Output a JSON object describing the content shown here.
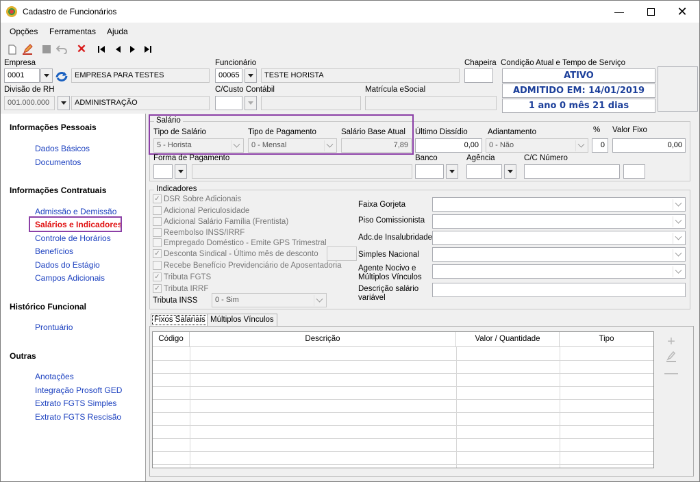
{
  "window": {
    "title": "Cadastro de Funcionários",
    "min_icon": "minimize-icon",
    "max_icon": "maximize-icon",
    "close_icon": "close-icon"
  },
  "menu": [
    {
      "label": "Opções"
    },
    {
      "label": "Ferramentas"
    },
    {
      "label": "Ajuda"
    }
  ],
  "toolbar": {
    "icons": [
      "new-document-icon",
      "edit-icon",
      "save-icon",
      "undo-icon",
      "delete-icon",
      "first-record-icon",
      "previous-record-icon",
      "next-record-icon",
      "last-record-icon"
    ]
  },
  "header": {
    "empresa_label": "Empresa",
    "empresa_code": "0001",
    "empresa_name": "EMPRESA PARA TESTES",
    "divisao_label": "Divisão de RH",
    "divisao_code": "001.000.000",
    "divisao_name": "ADMINISTRAÇÃO",
    "funcionario_label": "Funcionário",
    "funcionario_code": "00065",
    "funcionario_name": "TESTE HORISTA",
    "custo_label": "C/Custo Contábil",
    "custo_code": "",
    "custo_name": "",
    "matricula_label": "Matrícula eSocial",
    "matricula_value": "",
    "chapeira_label": "Chapeira",
    "chapeira_value": "",
    "condicao_label": "Condição Atual e Tempo de Serviço",
    "status": "ATIVO",
    "admitido": "ADMITIDO EM: 14/01/2019",
    "tempo": "1 ano 0 mês 21 dias"
  },
  "nav": {
    "sections": [
      {
        "title": "Informações Pessoais",
        "links": [
          "Dados Básicos",
          "Documentos"
        ]
      },
      {
        "title": "Informações Contratuais",
        "links": [
          "Admissão e Demissão",
          "Salários e Indicadores",
          "Controle de Horários",
          "Benefícios",
          "Dados do Estágio",
          "Campos Adicionais"
        ]
      },
      {
        "title": "Histórico Funcional",
        "links": [
          "Prontuário"
        ]
      },
      {
        "title": "Outras",
        "links": [
          "Anotações",
          "Integração Prosoft GED",
          "Extrato FGTS Simples",
          "Extrato FGTS Rescisão"
        ]
      }
    ],
    "active": "Salários e Indicadores"
  },
  "salario": {
    "group_title": "Salário",
    "tipo_salario_label": "Tipo de Salário",
    "tipo_salario_value": "5 - Horista",
    "tipo_pagamento_label": "Tipo de Pagamento",
    "tipo_pagamento_value": "0 - Mensal",
    "salario_base_label": "Salário Base Atual",
    "salario_base_value": "7,89",
    "ultimo_dissidio_label": "Último Dissídio",
    "ultimo_dissidio_value": "0,00",
    "adiantamento_label": "Adiantamento",
    "adiantamento_value": "0 - Não",
    "percent_label": "%",
    "percent_value": "0",
    "valor_fixo_label": "Valor Fixo",
    "valor_fixo_value": "0,00",
    "forma_pagamento_label": "Forma de Pagamento",
    "forma_pagamento_value": "",
    "banco_label": "Banco",
    "agencia_label": "Agência",
    "cc_numero_label": "C/C Número"
  },
  "indicadores": {
    "group_title": "Indicadores",
    "checks": [
      {
        "label": "DSR Sobre Adicionais",
        "checked": true
      },
      {
        "label": "Adicional Periculosidade",
        "checked": false
      },
      {
        "label": "Adicional Salário Família (Frentista)",
        "checked": false
      },
      {
        "label": "Reembolso INSS/IRRF",
        "checked": false
      },
      {
        "label": "Empregado Doméstico - Emite GPS Trimestral",
        "checked": false
      },
      {
        "label": "Desconta Sindical - Último mês de desconto",
        "checked": true
      },
      {
        "label": "Recebe Benefício Previdenciário de Aposentadoria",
        "checked": false
      },
      {
        "label": "Tributa FGTS",
        "checked": true
      },
      {
        "label": "Tributa IRRF",
        "checked": true
      }
    ],
    "tributa_inss_label": "Tributa INSS",
    "tributa_inss_value": "0 - Sim",
    "right_fields": [
      {
        "label": "Faixa Gorjeta"
      },
      {
        "label": "Piso Comissionista"
      },
      {
        "label": "Adc.de Insalubridade"
      },
      {
        "label": "Simples Nacional"
      },
      {
        "label": "Agente Nocivo e Múltiplos Vínculos"
      },
      {
        "label": "Descrição salário variável"
      }
    ]
  },
  "tabs": [
    {
      "label": "Fixos Salariais",
      "active": true
    },
    {
      "label": "Múltiplos Vínculos",
      "active": false
    }
  ],
  "grid": {
    "columns": [
      "Código",
      "Descrição",
      "Valor / Quantidade",
      "Tipo"
    ]
  },
  "side_actions": [
    "add-icon",
    "edit-icon",
    "remove-icon"
  ]
}
